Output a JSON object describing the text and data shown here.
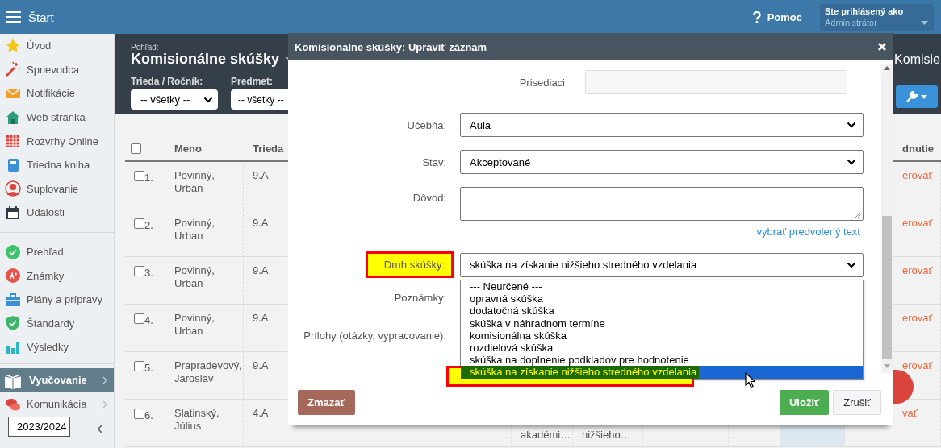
{
  "topbar": {
    "title": "Štart",
    "help": "Pomoc",
    "user_label": "Ste prihlásený ako",
    "user_name": "Administrátor"
  },
  "sidebar": {
    "groups": [
      {
        "items": [
          {
            "label": "Úvod",
            "selected": false,
            "expandable": false
          },
          {
            "label": "Sprievodca",
            "selected": false,
            "expandable": false
          },
          {
            "label": "Notifikácie",
            "selected": false,
            "expandable": false
          },
          {
            "label": "Web stránka",
            "selected": false,
            "expandable": false
          },
          {
            "label": "Rozvrhy Online",
            "selected": false,
            "expandable": false
          },
          {
            "label": "Triedna kniha",
            "selected": false,
            "expandable": false
          },
          {
            "label": "Suplovanie",
            "selected": false,
            "expandable": false
          },
          {
            "label": "Udalosti",
            "selected": false,
            "expandable": false
          }
        ]
      },
      {
        "items": [
          {
            "label": "Prehľad",
            "selected": false,
            "expandable": false
          },
          {
            "label": "Známky",
            "selected": false,
            "expandable": false
          },
          {
            "label": "Plány a prípravy",
            "selected": false,
            "expandable": false
          },
          {
            "label": "Štandardy",
            "selected": false,
            "expandable": false
          },
          {
            "label": "Výsledky",
            "selected": false,
            "expandable": false
          }
        ]
      },
      {
        "items": [
          {
            "label": "Vyučovanie",
            "selected": true,
            "expandable": true
          },
          {
            "label": "Komunikácia",
            "selected": false,
            "expandable": true
          }
        ]
      }
    ],
    "year_select": "2023/2024"
  },
  "view": {
    "label": "Pohľad:",
    "title": "Komisionálne skúšky",
    "right_title": "Komisie",
    "filters": [
      {
        "label": "Trieda / Ročník:",
        "value": "-- všetky --"
      },
      {
        "label": "Predmet:",
        "value": "-- všetky --"
      }
    ]
  },
  "table": {
    "header": {
      "checked": false,
      "name": "Meno",
      "class": "Trieda",
      "column_10": "dnutie"
    },
    "rows": [
      {
        "checked": false,
        "number": "1.",
        "name": "Povinný, Urban",
        "class": "9.A",
        "column_10": "erovať"
      },
      {
        "checked": false,
        "number": "2.",
        "name": "Povinný, Urban",
        "class": "9.A",
        "column_10": "erovať"
      },
      {
        "checked": false,
        "number": "3.",
        "name": "Povinný, Urban",
        "class": "9.A",
        "column_10": "erovať"
      },
      {
        "checked": false,
        "number": "4.",
        "name": "Povinný, Urban",
        "class": "9.A",
        "column_10": "erovať"
      },
      {
        "checked": false,
        "number": "5.",
        "name": "Prapradevový, Jaroslav",
        "class": "9.A",
        "column_10": "erovať"
      },
      {
        "checked": false,
        "number": "6.",
        "name": "Slatinský, Július",
        "class": "4.A",
        "column_4": "akadémi…",
        "column_5": "nižšieho…",
        "column_10": "vať",
        "marked": true
      }
    ]
  },
  "modal": {
    "title": "Komisionálne skúšky: Upraviť záznam",
    "fields": [
      {
        "kind": "input",
        "label": "Prisediaci",
        "disabled": true,
        "highlighted": false
      },
      {
        "kind": "select",
        "label": "Učebňa:",
        "value": "Aula",
        "highlighted": false
      },
      {
        "kind": "select",
        "label": "Stav:",
        "value": "Akceptované",
        "highlighted": false
      },
      {
        "kind": "textarea",
        "label": "Dôvod:",
        "highlighted": false
      },
      {
        "kind": "link",
        "text": "vybrať predvolený text"
      },
      {
        "kind": "select",
        "label": "Druh skúšky:",
        "value": "skúška na získanie nižšieho stredného vzdelania",
        "open": true,
        "highlighted": true,
        "options": [
          {
            "label": "--- Neurčené ---",
            "selected": false,
            "highlighted": false
          },
          {
            "label": "opravná skúška",
            "selected": false,
            "highlighted": false
          },
          {
            "label": "dodatočná skúška",
            "selected": false,
            "highlighted": false
          },
          {
            "label": "skúška v náhradnom termíne",
            "selected": false,
            "highlighted": false
          },
          {
            "label": "komisionálna skúška",
            "selected": false,
            "highlighted": false
          },
          {
            "label": "rozdielová skúška",
            "selected": false,
            "highlighted": false
          },
          {
            "label": "skúška na doplnenie podkladov pre hodnotenie",
            "selected": false,
            "highlighted": false
          },
          {
            "label": "skúška na získanie nižšieho stredného vzdelania",
            "selected": true,
            "highlighted": true
          }
        ]
      },
      {
        "kind": "label-only",
        "label": "Poznámky:",
        "highlighted": false
      },
      {
        "kind": "label-only",
        "label": "Prílohy (otázky, vypracovanie):",
        "highlighted": false
      }
    ],
    "buttons": [
      {
        "kind": "danger",
        "label": "Zmazať"
      },
      {
        "kind": "primary",
        "label": "Uložiť"
      },
      {
        "kind": "default",
        "label": "Zrušiť"
      }
    ]
  }
}
